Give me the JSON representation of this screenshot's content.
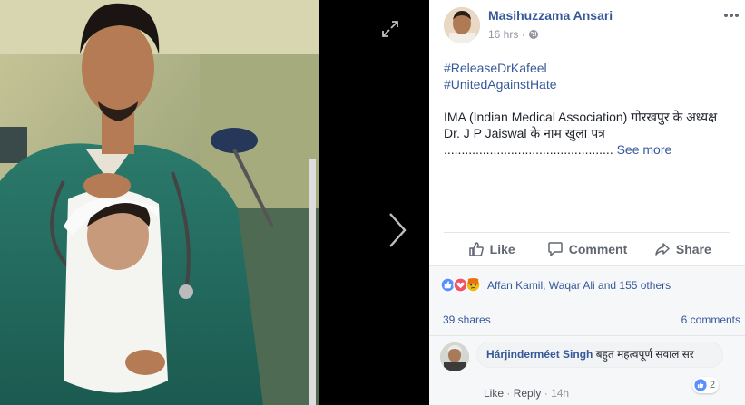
{
  "viewer": {
    "expand_icon": "expand-icon",
    "next_icon": "chevron-right-icon"
  },
  "post": {
    "author": "Masihuzzama Ansari",
    "time": "16 hrs",
    "separator": "·",
    "hashtags": [
      "#ReleaseDrKafeel",
      "#UnitedAgainstHate"
    ],
    "text_line1": "IMA (Indian Medical Association) गोरखपुर के अध्यक्ष",
    "text_line2": "Dr. J P Jaiswal के नाम खुला पत्र",
    "ellipsis": "................................................",
    "see_more": "See more"
  },
  "actions": {
    "like": "Like",
    "comment": "Comment",
    "share": "Share"
  },
  "reactions": {
    "summary": "Affan Kamil, Waqar Ali and 155 others",
    "icons": [
      "like-reaction-icon",
      "love-reaction-icon",
      "angry-reaction-icon"
    ]
  },
  "counts": {
    "shares": "39 shares",
    "comments": "6 comments"
  },
  "comment": {
    "author": "Hárjinderméet Singh",
    "text": "बहुत महत्वपूर्ण सवाल सर",
    "like": "Like",
    "reply": "Reply",
    "time": "14h",
    "reaction_count": "2"
  },
  "colors": {
    "link": "#365899",
    "muted": "#90949c",
    "panel_bg": "#ffffff",
    "footer_bg": "#f6f7f9",
    "like_blue": "#5890ff"
  }
}
